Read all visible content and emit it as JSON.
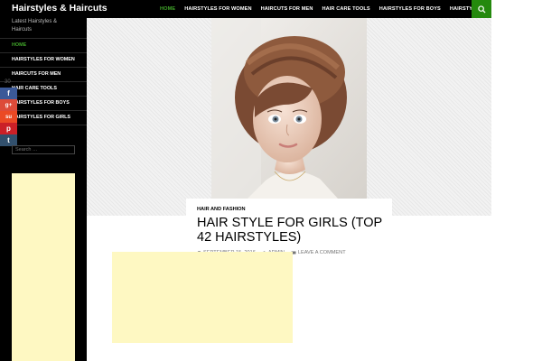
{
  "site": {
    "title": "Hairstyles & Haircuts",
    "tagline": "Latest Hairstyles & Haircuts"
  },
  "nav": {
    "items": [
      {
        "label": "HOME",
        "active": true
      },
      {
        "label": "HAIRSTYLES FOR WOMEN",
        "active": false
      },
      {
        "label": "HAIRCUTS FOR MEN",
        "active": false
      },
      {
        "label": "HAIR CARE TOOLS",
        "active": false
      },
      {
        "label": "HAIRSTYLES FOR BOYS",
        "active": false
      },
      {
        "label": "HAIRSTYLES FOR GIRLS",
        "active": false
      }
    ],
    "search_icon": "search-icon"
  },
  "sidebar": {
    "items": [
      {
        "label": "HOME",
        "active": true
      },
      {
        "label": "HAIRSTYLES FOR WOMEN",
        "active": false
      },
      {
        "label": "HAIRCUTS FOR MEN",
        "active": false
      },
      {
        "label": "HAIR CARE TOOLS",
        "active": false
      },
      {
        "label": "HAIRSTYLES FOR BOYS",
        "active": false
      },
      {
        "label": "HAIRSTYLES FOR GIRLS",
        "active": false
      }
    ],
    "share_count": "30",
    "share_buttons": [
      {
        "icon": "facebook-icon",
        "glyph": "f",
        "color": "#3b5998"
      },
      {
        "icon": "google-plus-icon",
        "glyph": "g+",
        "color": "#dd4b39"
      },
      {
        "icon": "stumbleupon-icon",
        "glyph": "su",
        "color": "#eb4924"
      },
      {
        "icon": "pinterest-icon",
        "glyph": "p",
        "color": "#cb2027"
      },
      {
        "icon": "tumblr-icon",
        "glyph": "t",
        "color": "#32506d"
      }
    ],
    "search_placeholder": "Search …"
  },
  "post": {
    "category": "HAIR AND FASHION",
    "title": "HAIR STYLE FOR GIRLS (TOP 42 HAIRSTYLES)",
    "date": "SEPTEMBER 15, 2016",
    "author": "ADMIN",
    "comments": "LEAVE A COMMENT"
  },
  "colors": {
    "accent": "#41a62a",
    "search_button": "#24890d",
    "ad_background": "#fef8c2"
  }
}
